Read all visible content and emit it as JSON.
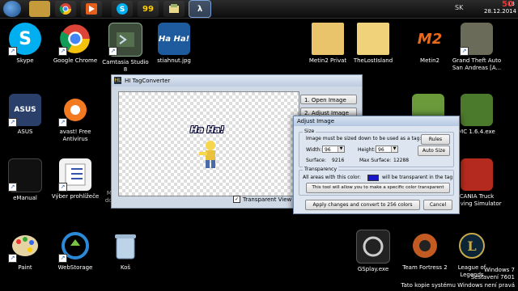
{
  "taskbar": {
    "buttons": [
      {
        "name": "folder"
      },
      {
        "name": "chrome"
      },
      {
        "name": "media"
      },
      {
        "name": "skype"
      },
      {
        "name": "app-99",
        "label": "99"
      },
      {
        "name": "notes"
      },
      {
        "name": "halflife",
        "label": "λ"
      }
    ],
    "lang": "SK",
    "time": "13",
    "date": "28.12.2014",
    "warning": "50"
  },
  "desktop_icons": [
    {
      "label": "Skype"
    },
    {
      "label": "Google Chrome"
    },
    {
      "label": "Camtasia Studio 8"
    },
    {
      "label": "stiahnut.jpg",
      "badge": "Ha Ha!"
    },
    {
      "label": "Metin2 Privat"
    },
    {
      "label": "TheLostIsland"
    },
    {
      "label": "Metin2",
      "badge": "M2"
    },
    {
      "label": "Grand Theft Auto San Andreas [A..."
    },
    {
      "label": "ASUS",
      "badge": "ASUS"
    },
    {
      "label": "avast! Free Antivirus"
    },
    {
      "label": "MC 1.6.4.exe"
    },
    {
      "label": "eManual"
    },
    {
      "label": "Výber prohlížeče"
    },
    {
      "label": "Moje obrázky dokumenty -_-"
    },
    {
      "label": "CANIA Truck Driving Simulator"
    },
    {
      "label": "Paint"
    },
    {
      "label": "WebStorage"
    },
    {
      "label": "Koš"
    },
    {
      "label": "GSplay.exe"
    },
    {
      "label": "Team Fortress 2"
    },
    {
      "label": "League of Legends"
    }
  ],
  "tag_converter": {
    "title": "HI TagConverter",
    "logo": "HL",
    "preview_text": "Ha Ha!",
    "buttons": [
      "1. Open Image",
      "2. Adjust Image"
    ],
    "transparent_view_label": "Transparent View",
    "transparent_view_checked": true
  },
  "adjust_image": {
    "title": "Adjust Image",
    "size_legend": "Size",
    "size_note": "Image must be sized down to be used as a tag:",
    "rules_label": "Rules",
    "width_label": "Width:",
    "width_value": "96",
    "height_label": "Height:",
    "height_value": "96",
    "auto_size_label": "Auto Size",
    "surface_label": "Surface:",
    "surface_value": "9216",
    "max_surface_label": "Max Surface:",
    "max_surface_value": "12288",
    "transparency_legend": "Transparency",
    "transparency_prefix": "All areas with this color:",
    "transparency_suffix": "will be transparent in the tag",
    "transparent_color": "#1818c8",
    "transparency_button": "This tool will allow you to make a specific color transparent",
    "apply_label": "Apply changes and convert to 256 colors",
    "cancel_label": "Cancel"
  },
  "watermark": {
    "line1": "Windows 7",
    "line2": "Sestavení 7601",
    "line3": "Tato kopie systému Windows není pravá"
  }
}
